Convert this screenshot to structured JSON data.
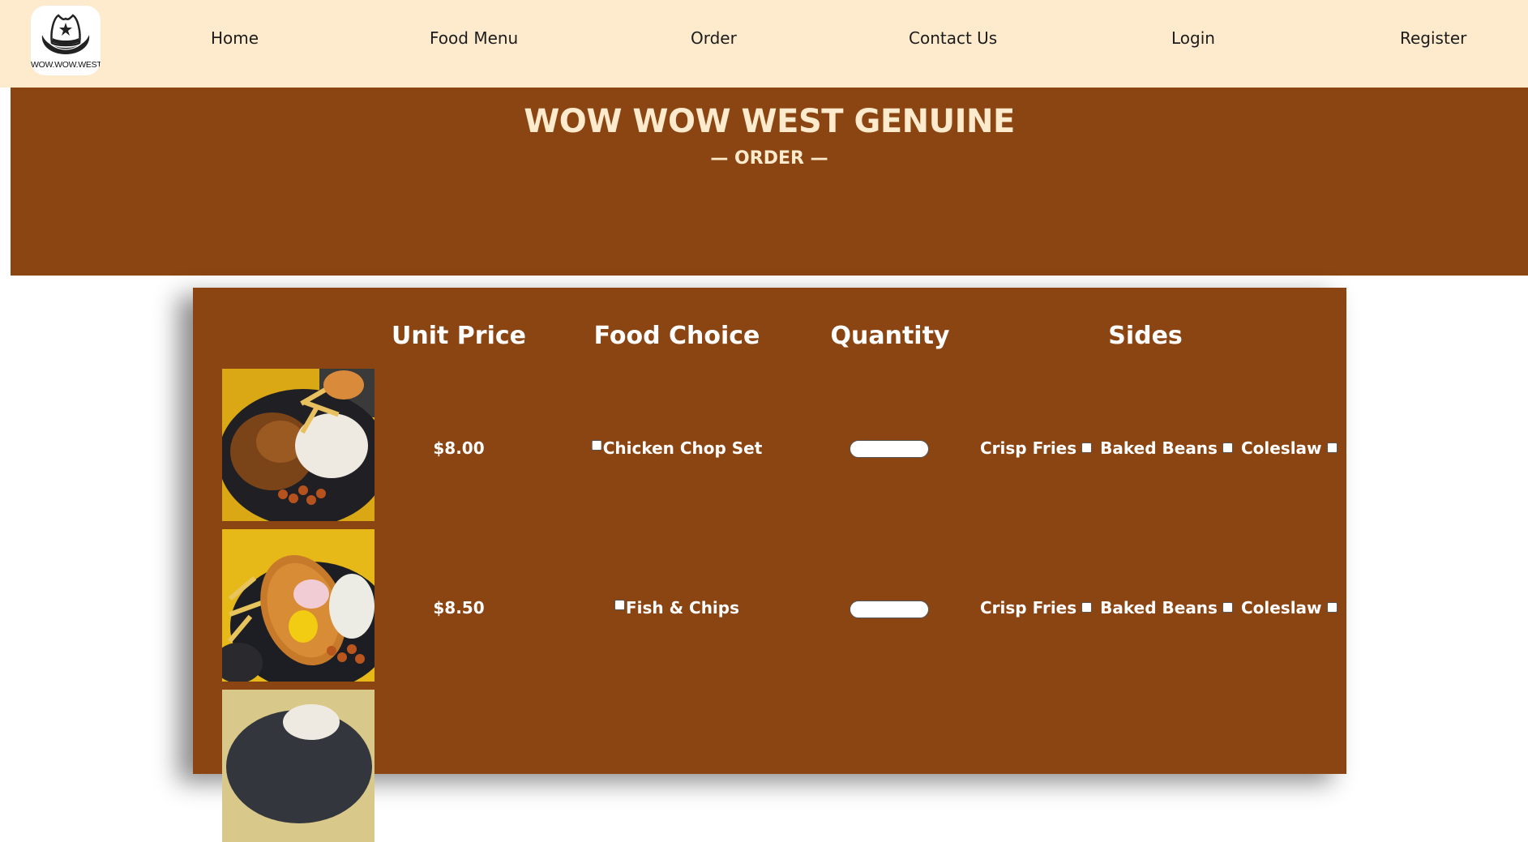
{
  "brand": {
    "logo_text": "WOW.WOW.WEST"
  },
  "nav": {
    "items": [
      {
        "label": "Home"
      },
      {
        "label": "Food Menu"
      },
      {
        "label": "Order"
      },
      {
        "label": "Contact Us"
      },
      {
        "label": "Login"
      },
      {
        "label": "Register"
      }
    ]
  },
  "hero": {
    "title": "WOW WOW WEST GENUINE",
    "subtitle": "— ORDER —"
  },
  "order_table": {
    "columns": [
      "Unit Price",
      "Food Choice",
      "Quantity",
      "Sides"
    ],
    "rows": [
      {
        "image": "chicken-chop-photo",
        "price": "$8.00",
        "food": "Chicken Chop Set",
        "quantity": "",
        "sides": [
          "Crisp Fries",
          "Baked Beans",
          "Coleslaw"
        ]
      },
      {
        "image": "fish-and-chips-photo",
        "price": "$8.50",
        "food": "Fish & Chips",
        "quantity": "",
        "sides": [
          "Crisp Fries",
          "Baked Beans",
          "Coleslaw"
        ]
      },
      {
        "image": "third-dish-photo"
      }
    ]
  },
  "colors": {
    "nav_bg": "#feebcd",
    "brown": "#8b4513",
    "hero_text": "#feebcd",
    "table_text": "#ffffff"
  }
}
